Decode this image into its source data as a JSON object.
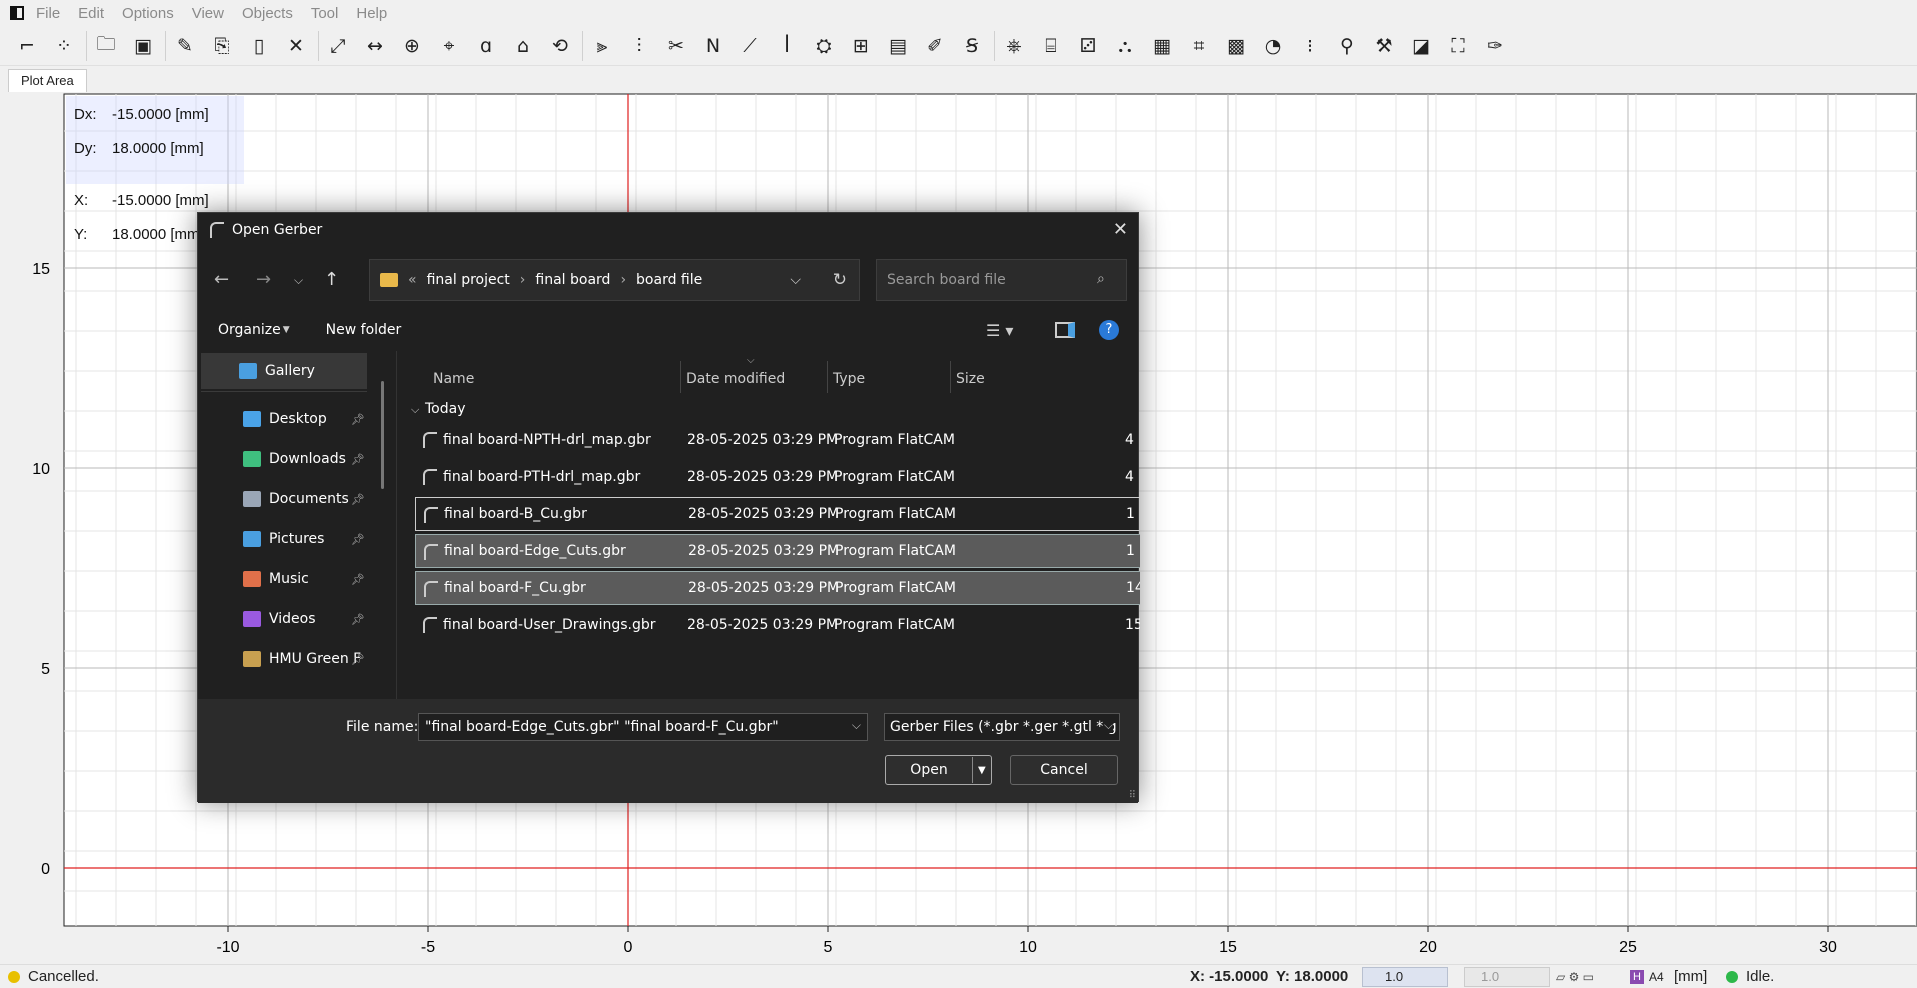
{
  "menu": [
    "File",
    "Edit",
    "Options",
    "View",
    "Objects",
    "Tool",
    "Help"
  ],
  "toolbar_icons": [
    "gerber-icon",
    "excellon-icon",
    "open-folder-icon",
    "save-icon",
    "edit-icon",
    "copy-icon",
    "new-file-icon",
    "delete-icon",
    "zoom-fit-icon",
    "distance-icon",
    "origin-icon",
    "snap-icon",
    "jump-icon",
    "locate-icon",
    "replot-icon",
    "flip-icon",
    "align-icon",
    "cutout-icon",
    "ncc-icon",
    "paint-icon",
    "solder-icon",
    "panel-icon",
    "film-icon",
    "fiducial-icon",
    "copper-thieving-icon",
    "etch-icon",
    "milling-icon",
    "invert-icon",
    "extract-icon",
    "punch-icon",
    "calculator-icon",
    "transform-icon",
    "qrcode-icon",
    "check-icon",
    "corner-icon",
    "markers-icon",
    "optimal-icon",
    "subtract-icon",
    "fullscreen-icon",
    "drilling-icon"
  ],
  "tab": "Plot Area",
  "coords": {
    "dx_label": "Dx:",
    "dx": "-15.0000 [mm]",
    "dy_label": "Dy:",
    "dy": "18.0000 [mm]",
    "x_label": "X:",
    "x": "-15.0000 [mm]",
    "y_label": "Y:",
    "y": "18.0000 [mm]"
  },
  "plot": {
    "x_ticks": [
      "-10",
      "-5",
      "0",
      "5",
      "10",
      "15",
      "20",
      "25",
      "30"
    ],
    "y_ticks": [
      "15",
      "10",
      "5",
      "0"
    ]
  },
  "dialog": {
    "title": "Open Gerber",
    "breadcrumb": [
      "final project",
      "final board",
      "board file"
    ],
    "search_placeholder": "Search board file",
    "organize": "Organize",
    "new_folder": "New folder",
    "sidebar": [
      {
        "label": "Gallery",
        "color": "#4a9fe0"
      },
      {
        "label": "Desktop",
        "color": "#4aa3e8"
      },
      {
        "label": "Downloads",
        "color": "#3fbf7f"
      },
      {
        "label": "Documents",
        "color": "#9aa6b6"
      },
      {
        "label": "Pictures",
        "color": "#4a9fe0"
      },
      {
        "label": "Music",
        "color": "#e0704a"
      },
      {
        "label": "Videos",
        "color": "#9a5ae0"
      },
      {
        "label": "HMU Green F",
        "color": "#c8a050"
      }
    ],
    "columns": {
      "name": "Name",
      "date": "Date modified",
      "type": "Type",
      "size": "Size"
    },
    "group": "Today",
    "files": [
      {
        "name": "final board-NPTH-drl_map.gbr",
        "date": "28-05-2025 03:29 PM",
        "type": "Program FlatCAM",
        "size": "4"
      },
      {
        "name": "final board-PTH-drl_map.gbr",
        "date": "28-05-2025 03:29 PM",
        "type": "Program FlatCAM",
        "size": "4"
      },
      {
        "name": "final board-B_Cu.gbr",
        "date": "28-05-2025 03:29 PM",
        "type": "Program FlatCAM",
        "size": "1"
      },
      {
        "name": "final board-Edge_Cuts.gbr",
        "date": "28-05-2025 03:29 PM",
        "type": "Program FlatCAM",
        "size": "1"
      },
      {
        "name": "final board-F_Cu.gbr",
        "date": "28-05-2025 03:29 PM",
        "type": "Program FlatCAM",
        "size": "14"
      },
      {
        "name": "final board-User_Drawings.gbr",
        "date": "28-05-2025 03:29 PM",
        "type": "Program FlatCAM",
        "size": "15"
      }
    ],
    "file_name_label": "File name:",
    "file_name_value": "\"final board-Edge_Cuts.gbr\" \"final board-F_Cu.gbr\"",
    "file_type": "Gerber Files (*.gbr *.ger *.gtl *.g",
    "open": "Open",
    "cancel": "Cancel"
  },
  "status": {
    "message": "Cancelled.",
    "x": "X: -15.0000",
    "y": "Y: 18.0000",
    "grid_x": "1.0",
    "grid_y": "1.0",
    "page": "A4",
    "units": "[mm]",
    "state": "Idle."
  }
}
